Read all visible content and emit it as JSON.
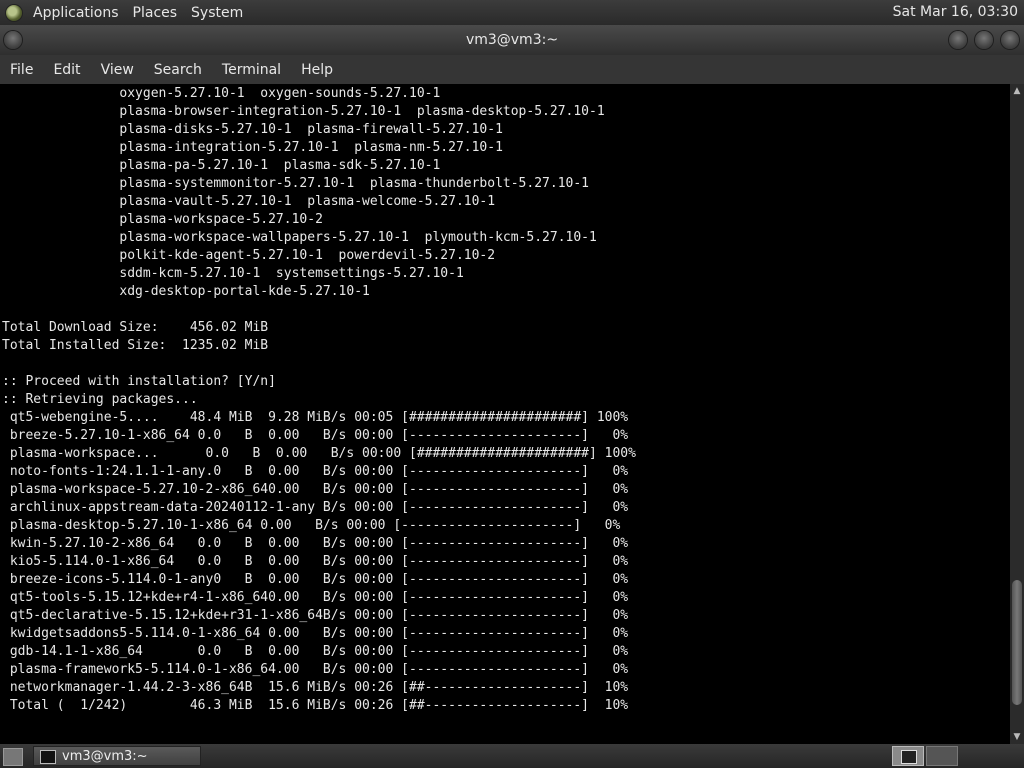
{
  "top_panel": {
    "menus": [
      "Applications",
      "Places",
      "System"
    ],
    "clock": "Sat Mar 16, 03:30"
  },
  "window": {
    "title": "vm3@vm3:~"
  },
  "menubar": [
    "File",
    "Edit",
    "View",
    "Search",
    "Terminal",
    "Help"
  ],
  "terminal": {
    "lines": [
      "               oxygen-5.27.10-1  oxygen-sounds-5.27.10-1",
      "               plasma-browser-integration-5.27.10-1  plasma-desktop-5.27.10-1",
      "               plasma-disks-5.27.10-1  plasma-firewall-5.27.10-1",
      "               plasma-integration-5.27.10-1  plasma-nm-5.27.10-1",
      "               plasma-pa-5.27.10-1  plasma-sdk-5.27.10-1",
      "               plasma-systemmonitor-5.27.10-1  plasma-thunderbolt-5.27.10-1",
      "               plasma-vault-5.27.10-1  plasma-welcome-5.27.10-1",
      "               plasma-workspace-5.27.10-2",
      "               plasma-workspace-wallpapers-5.27.10-1  plymouth-kcm-5.27.10-1",
      "               polkit-kde-agent-5.27.10-1  powerdevil-5.27.10-2",
      "               sddm-kcm-5.27.10-1  systemsettings-5.27.10-1",
      "               xdg-desktop-portal-kde-5.27.10-1",
      "",
      "Total Download Size:    456.02 MiB",
      "Total Installed Size:  1235.02 MiB",
      "",
      ":: Proceed with installation? [Y/n]",
      ":: Retrieving packages...",
      " qt5-webengine-5....    48.4 MiB  9.28 MiB/s 00:05 [######################] 100%",
      " breeze-5.27.10-1-x86_64 0.0   B  0.00   B/s 00:00 [----------------------]   0%",
      " plasma-workspace...      0.0   B  0.00   B/s 00:00 [######################] 100%",
      " noto-fonts-1:24.1.1-1-any.0   B  0.00   B/s 00:00 [----------------------]   0%",
      " plasma-workspace-5.27.10-2-x86_640.00   B/s 00:00 [----------------------]   0%",
      " archlinux-appstream-data-20240112-1-any B/s 00:00 [----------------------]   0%",
      " plasma-desktop-5.27.10-1-x86_64 0.00   B/s 00:00 [----------------------]   0%",
      " kwin-5.27.10-2-x86_64   0.0   B  0.00   B/s 00:00 [----------------------]   0%",
      " kio5-5.114.0-1-x86_64   0.0   B  0.00   B/s 00:00 [----------------------]   0%",
      " breeze-icons-5.114.0-1-any0   B  0.00   B/s 00:00 [----------------------]   0%",
      " qt5-tools-5.15.12+kde+r4-1-x86_640.00   B/s 00:00 [----------------------]   0%",
      " qt5-declarative-5.15.12+kde+r31-1-x86_64B/s 00:00 [----------------------]   0%",
      " kwidgetsaddons5-5.114.0-1-x86_64 0.00   B/s 00:00 [----------------------]   0%",
      " gdb-14.1-1-x86_64       0.0   B  0.00   B/s 00:00 [----------------------]   0%",
      " plasma-framework5-5.114.0-1-x86_64.00   B/s 00:00 [----------------------]   0%",
      " networkmanager-1.44.2-3-x86_64B  15.6 MiB/s 00:26 [##--------------------]  10%",
      " Total (  1/242)        46.3 MiB  15.6 MiB/s 00:26 [##--------------------]  10%"
    ]
  },
  "scrollbar": {
    "position_fraction": 0.95
  },
  "taskbar": {
    "task_label": "vm3@vm3:~"
  }
}
